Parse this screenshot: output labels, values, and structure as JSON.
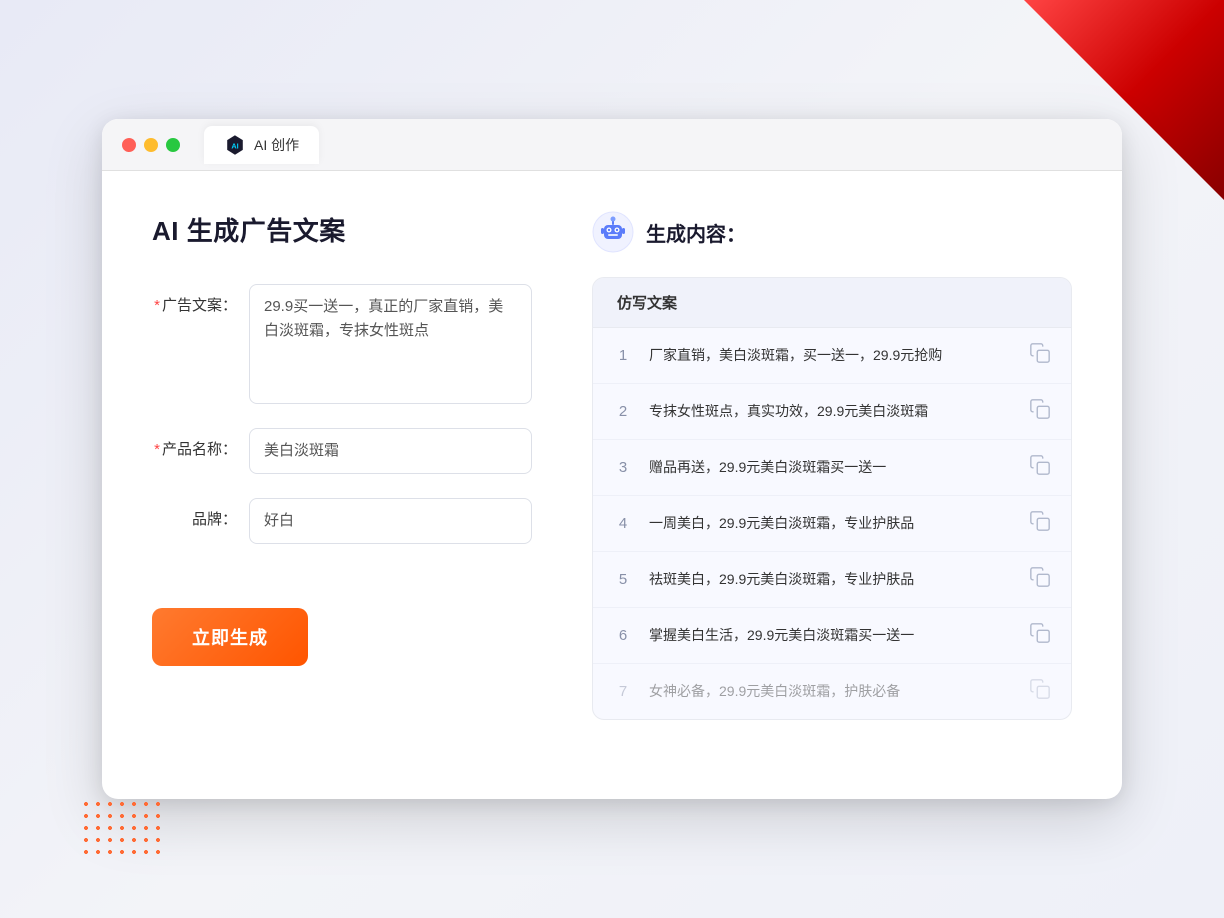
{
  "window": {
    "tab_label": "AI 创作"
  },
  "page": {
    "title": "AI 生成广告文案"
  },
  "form": {
    "ad_copy_label": "广告文案：",
    "ad_copy_required": "*",
    "ad_copy_value": "29.9买一送一，真正的厂家直销，美白淡斑霜，专抹女性斑点",
    "product_name_label": "产品名称：",
    "product_name_required": "*",
    "product_name_value": "美白淡斑霜",
    "brand_label": "品牌：",
    "brand_value": "好白",
    "generate_button_label": "立即生成"
  },
  "result": {
    "header_label": "生成内容：",
    "column_header": "仿写文案",
    "items": [
      {
        "number": "1",
        "text": "厂家直销，美白淡斑霜，买一送一，29.9元抢购",
        "faded": false
      },
      {
        "number": "2",
        "text": "专抹女性斑点，真实功效，29.9元美白淡斑霜",
        "faded": false
      },
      {
        "number": "3",
        "text": "赠品再送，29.9元美白淡斑霜买一送一",
        "faded": false
      },
      {
        "number": "4",
        "text": "一周美白，29.9元美白淡斑霜，专业护肤品",
        "faded": false
      },
      {
        "number": "5",
        "text": "祛斑美白，29.9元美白淡斑霜，专业护肤品",
        "faded": false
      },
      {
        "number": "6",
        "text": "掌握美白生活，29.9元美白淡斑霜买一送一",
        "faded": false
      },
      {
        "number": "7",
        "text": "女神必备，29.9元美白淡斑霜，护肤必备",
        "faded": true
      }
    ]
  }
}
